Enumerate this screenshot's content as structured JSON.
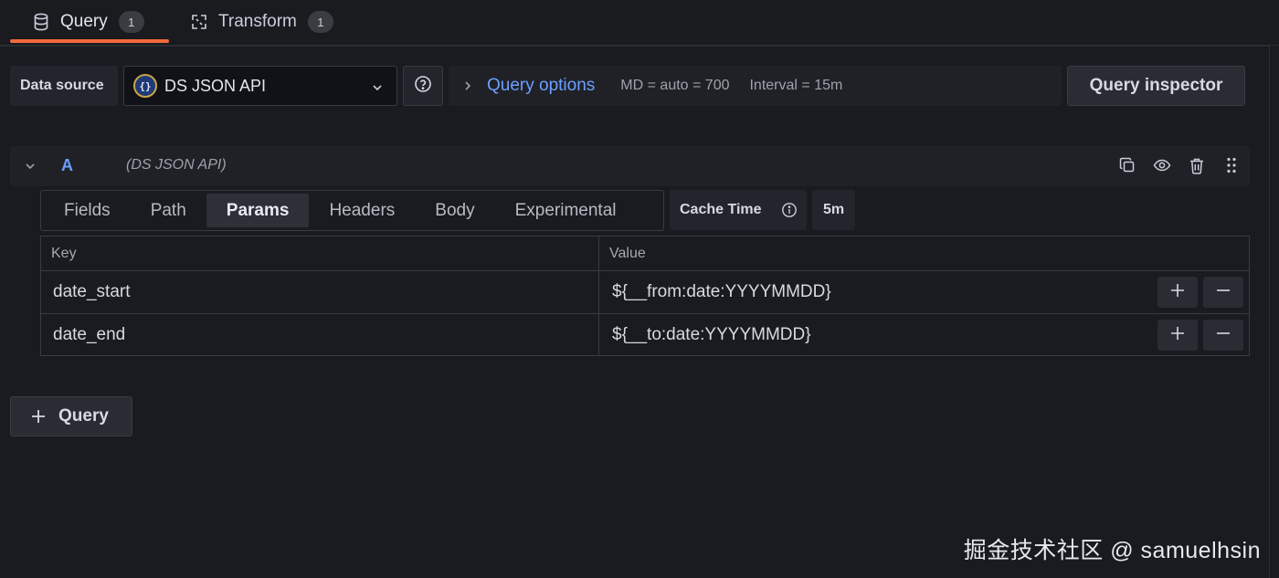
{
  "tabs": [
    {
      "label": "Query",
      "count": "1",
      "icon": "database-icon"
    },
    {
      "label": "Transform",
      "count": "1",
      "icon": "transform-icon"
    }
  ],
  "datasource": {
    "label": "Data source",
    "selected": "DS JSON API",
    "logo_text": "{}"
  },
  "query_options": {
    "title": "Query options",
    "md": "MD = auto = 700",
    "interval": "Interval = 15m"
  },
  "query_inspector_label": "Query inspector",
  "query_row": {
    "ref_id": "A",
    "datasource_name": "(DS JSON API)"
  },
  "plugin_tabs": [
    "Fields",
    "Path",
    "Params",
    "Headers",
    "Body",
    "Experimental"
  ],
  "active_plugin_tab": "Params",
  "cache": {
    "label": "Cache Time",
    "value": "5m"
  },
  "params_table": {
    "headers": [
      "Key",
      "Value"
    ],
    "rows": [
      {
        "key": "date_start",
        "value": "${__from:date:YYYYMMDD}"
      },
      {
        "key": "date_end",
        "value": "${__to:date:YYYYMMDD}"
      }
    ]
  },
  "add_query_label": "Query",
  "watermark": "掘金技术社区 @ samuelhsin",
  "colors": {
    "accent": "#f26a3d",
    "link": "#6e9fff",
    "background": "#181b1f"
  }
}
